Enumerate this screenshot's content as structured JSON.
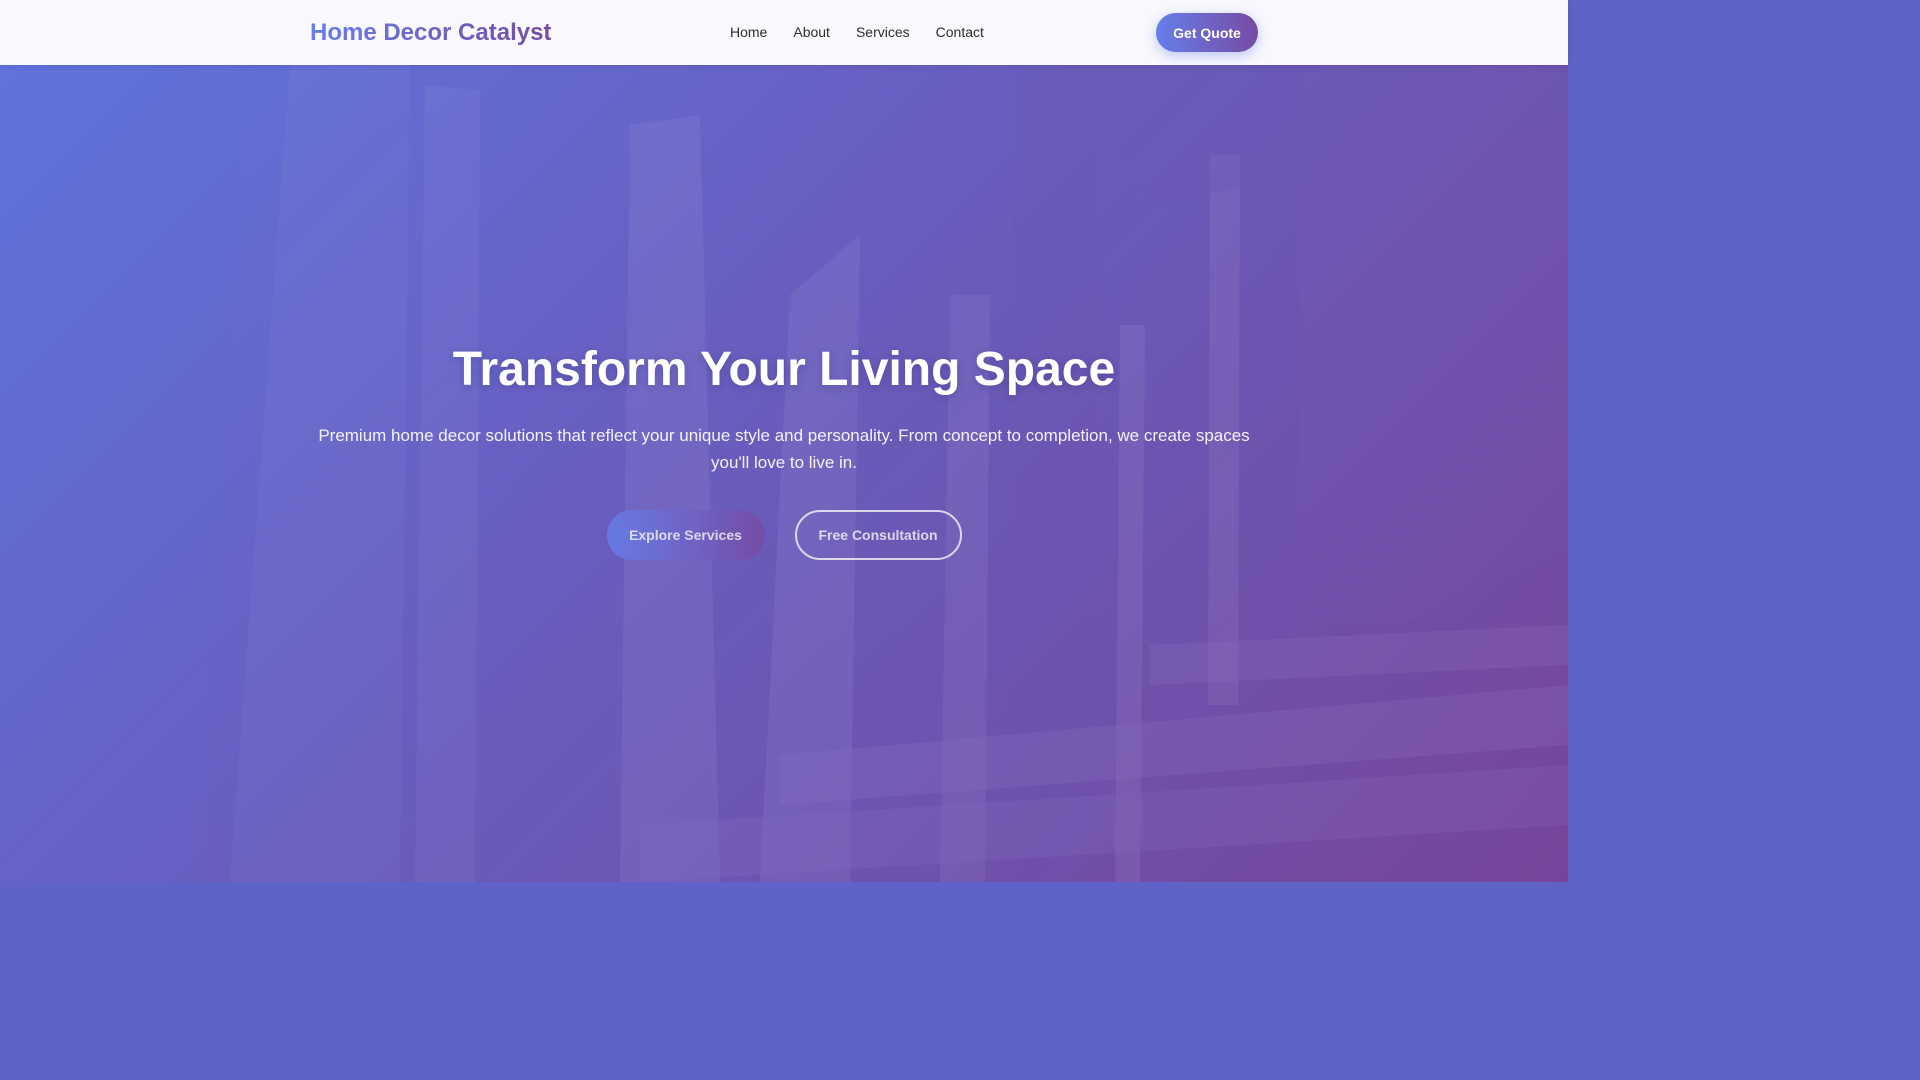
{
  "header": {
    "logo": "Home Decor Catalyst",
    "nav": [
      {
        "label": "Home"
      },
      {
        "label": "About"
      },
      {
        "label": "Services"
      },
      {
        "label": "Contact"
      }
    ],
    "cta_label": "Get Quote"
  },
  "hero": {
    "title": "Transform Your Living Space",
    "subtitle": "Premium home decor solutions that reflect your unique style and personality. From concept to completion, we create spaces you'll love to live in.",
    "primary_button": "Explore Services",
    "secondary_button": "Free Consultation"
  },
  "colors": {
    "brand_start": "#667eea",
    "brand_end": "#764ba2",
    "header_bg": "#f8f8fd",
    "nav_text": "#2d2d2d",
    "white": "#ffffff"
  }
}
